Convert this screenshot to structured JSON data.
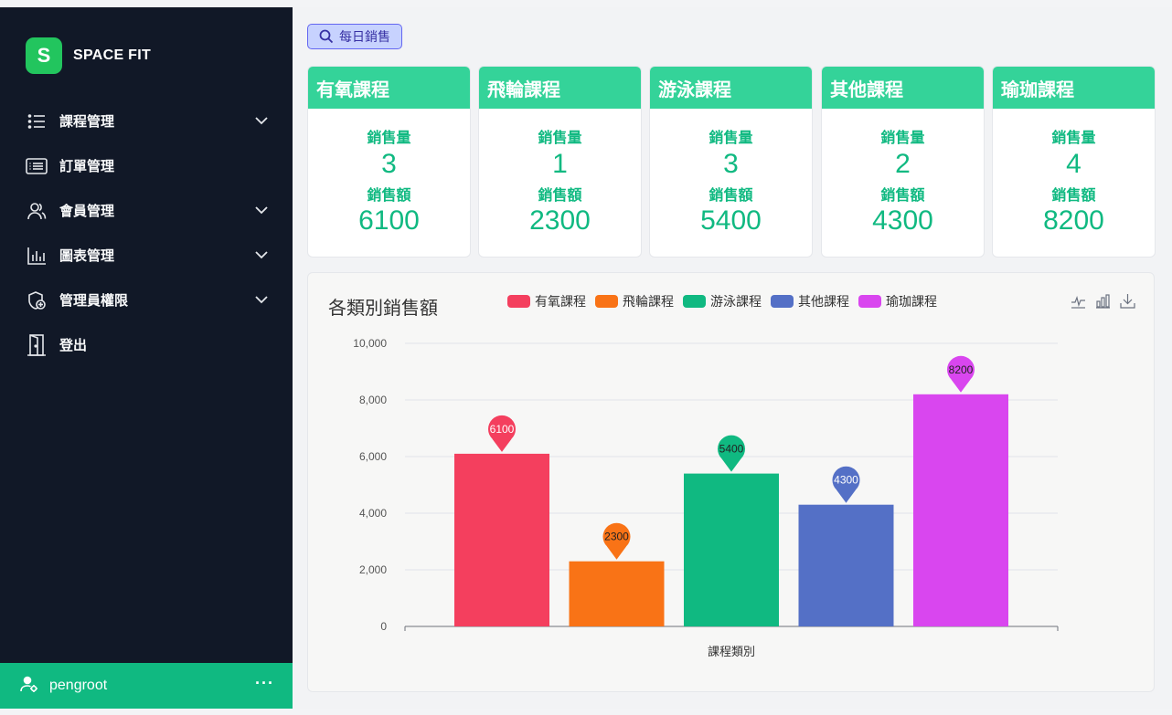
{
  "brand": {
    "logo_letter": "S",
    "name": "SPACE FIT"
  },
  "sidebar": {
    "items": [
      {
        "label": "課程管理",
        "icon": "list-icon",
        "has_submenu": true
      },
      {
        "label": "訂單管理",
        "icon": "receipt-list-icon",
        "has_submenu": false
      },
      {
        "label": "會員管理",
        "icon": "users-icon",
        "has_submenu": true
      },
      {
        "label": "圖表管理",
        "icon": "bar-chart-icon",
        "has_submenu": true
      },
      {
        "label": "管理員權限",
        "icon": "shield-plus-icon",
        "has_submenu": true
      },
      {
        "label": "登出",
        "icon": "door-icon",
        "has_submenu": false
      }
    ],
    "user": {
      "name": "pengroot",
      "more": "···"
    }
  },
  "filter_button": {
    "label": "每日銷售",
    "icon": "search-icon"
  },
  "cards": [
    {
      "title": "有氧課程",
      "qty_label": "銷售量",
      "qty": "3",
      "amount_label": "銷售額",
      "amount": "6100"
    },
    {
      "title": "飛輪課程",
      "qty_label": "銷售量",
      "qty": "1",
      "amount_label": "銷售額",
      "amount": "2300"
    },
    {
      "title": "游泳課程",
      "qty_label": "銷售量",
      "qty": "3",
      "amount_label": "銷售額",
      "amount": "5400"
    },
    {
      "title": "其他課程",
      "qty_label": "銷售量",
      "qty": "2",
      "amount_label": "銷售額",
      "amount": "4300"
    },
    {
      "title": "瑜珈課程",
      "qty_label": "銷售量",
      "qty": "4",
      "amount_label": "銷售額",
      "amount": "8200"
    }
  ],
  "colors": {
    "sidebar_bg": "#111827",
    "accent_green": "#10b981",
    "card_header": "#34d399"
  },
  "chart_data": {
    "type": "bar",
    "title": "各類別銷售額",
    "xlabel": "課程類別",
    "ylabel": "",
    "ylim": [
      0,
      10000
    ],
    "yticks": [
      "0",
      "2,000",
      "4,000",
      "6,000",
      "8,000",
      "10,000"
    ],
    "legend_position": "top",
    "grid": true,
    "series": [
      {
        "name": "有氧課程",
        "values": [
          6100
        ],
        "color": "#f43f5e"
      },
      {
        "name": "飛輪課程",
        "values": [
          2300
        ],
        "color": "#f97316"
      },
      {
        "name": "游泳課程",
        "values": [
          5400
        ],
        "color": "#10b981"
      },
      {
        "name": "其他課程",
        "values": [
          4300
        ],
        "color": "#5470c6"
      },
      {
        "name": "瑜珈課程",
        "values": [
          8200
        ],
        "color": "#d946ef"
      }
    ],
    "annotations": "max-point pins with value labels",
    "toolbox": [
      "line-chart-icon",
      "bar-chart-icon",
      "download-icon"
    ]
  }
}
